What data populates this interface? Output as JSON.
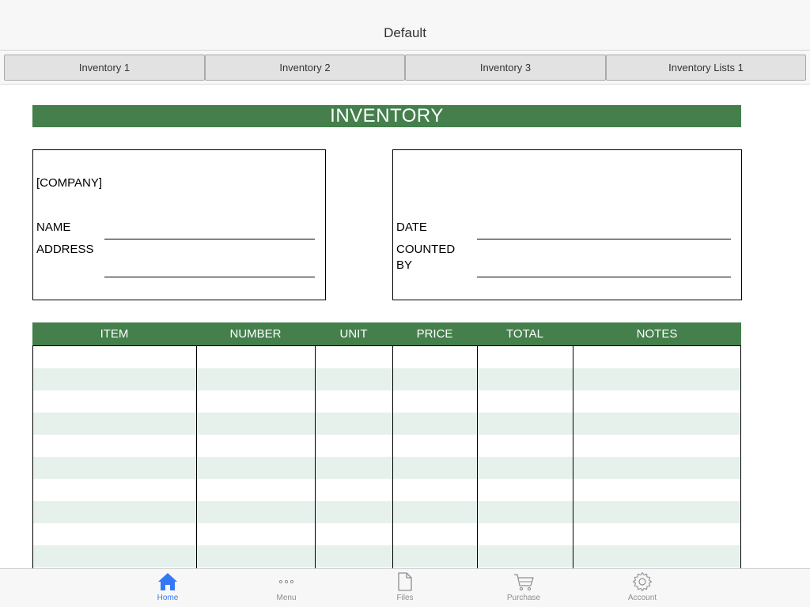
{
  "navbar": {
    "title": "Default"
  },
  "tabs": [
    {
      "label": "Inventory 1"
    },
    {
      "label": "Inventory 2"
    },
    {
      "label": "Inventory 3"
    },
    {
      "label": "Inventory Lists 1"
    }
  ],
  "sheet": {
    "title": "INVENTORY",
    "left_box": {
      "company": "[COMPANY]",
      "name_label": "NAME",
      "address_label": "ADDRESS"
    },
    "right_box": {
      "date_label": "DATE",
      "counted_label_1": "COUNTED",
      "counted_label_2": "BY"
    },
    "columns": [
      "ITEM",
      "NUMBER",
      "UNIT",
      "PRICE",
      "TOTAL",
      "NOTES"
    ],
    "row_count": 10
  },
  "tabbar": {
    "items": [
      {
        "label": "Home",
        "icon": "home-icon",
        "active": true
      },
      {
        "label": "Menu",
        "icon": "more-icon",
        "active": false
      },
      {
        "label": "Files",
        "icon": "file-icon",
        "active": false
      },
      {
        "label": "Purchase",
        "icon": "cart-icon",
        "active": false
      },
      {
        "label": "Account",
        "icon": "gear-icon",
        "active": false
      }
    ]
  },
  "colors": {
    "header_green": "#447f4c",
    "row_alt": "#e6f1ec",
    "active_blue": "#3478f6",
    "inactive_gray": "#8e8e93"
  }
}
